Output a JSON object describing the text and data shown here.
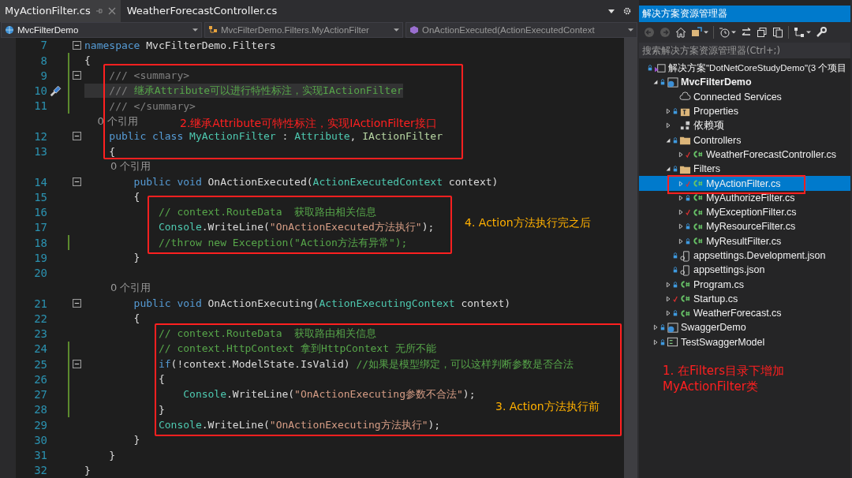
{
  "editor": {
    "tabs": [
      {
        "label": "MyActionFilter.cs",
        "selected": true
      },
      {
        "label": "WeatherForecastController.cs",
        "selected": false
      }
    ],
    "nav_bar": [
      {
        "kind": "project",
        "text": "MvcFilterDemo"
      },
      {
        "kind": "class",
        "text": "MvcFilterDemo.Filters.MyActionFilter"
      },
      {
        "kind": "method",
        "text": "OnActionExecuted(ActionExecutedContext"
      }
    ],
    "lines": [
      {
        "number": "7",
        "fold": true,
        "tokens": [
          {
            "kind": "kw",
            "text": "namespace"
          },
          {
            "kind": "plain",
            "text": " MvcFilterDemo.Filters"
          }
        ]
      },
      {
        "number": "8",
        "changed": true,
        "tokens": [
          {
            "kind": "plain",
            "text": "{"
          }
        ]
      },
      {
        "number": "9",
        "fold": true,
        "changed": true,
        "tokens": [
          {
            "kind": "doc",
            "text": "    /// <summary>"
          }
        ]
      },
      {
        "number": "10",
        "changed": true,
        "highlighted": true,
        "quick_action": true,
        "tokens": [
          {
            "kind": "doc",
            "text": "    /// "
          },
          {
            "kind": "comment",
            "text": "继承Attribute可以进行特性标注，实现IActionFilter"
          }
        ]
      },
      {
        "number": "11",
        "changed": true,
        "tokens": [
          {
            "kind": "doc",
            "text": "    /// </summary>"
          }
        ]
      },
      {
        "kind": "codelens",
        "text": "    0 个引用"
      },
      {
        "number": "12",
        "fold": true,
        "tokens": [
          {
            "kind": "kw",
            "text": "    public class"
          },
          {
            "kind": "type",
            "text": " MyActionFilter"
          },
          {
            "kind": "plain",
            "text": " : "
          },
          {
            "kind": "type",
            "text": "Attribute"
          },
          {
            "kind": "plain",
            "text": ", "
          },
          {
            "kind": "iface",
            "text": "IActionFilter"
          }
        ]
      },
      {
        "number": "13",
        "tokens": [
          {
            "kind": "plain",
            "text": "    {"
          }
        ]
      },
      {
        "kind": "codelens",
        "text": "        0 个引用"
      },
      {
        "number": "14",
        "fold": true,
        "tokens": [
          {
            "kind": "kw",
            "text": "        public void"
          },
          {
            "kind": "plain",
            "text": " OnActionExecuted("
          },
          {
            "kind": "type",
            "text": "ActionExecutedContext"
          },
          {
            "kind": "plain",
            "text": " context)"
          }
        ]
      },
      {
        "number": "15",
        "tokens": [
          {
            "kind": "plain",
            "text": "        {"
          }
        ]
      },
      {
        "number": "16",
        "tokens": [
          {
            "kind": "comment",
            "text": "            // context.RouteData  获取路由相关信息"
          }
        ]
      },
      {
        "number": "17",
        "tokens": [
          {
            "kind": "type",
            "text": "            Console"
          },
          {
            "kind": "plain",
            "text": ".WriteLine("
          },
          {
            "kind": "str",
            "text": "\"OnActionExecuted方法执行\""
          },
          {
            "kind": "plain",
            "text": ");"
          }
        ]
      },
      {
        "number": "18",
        "changed": true,
        "tokens": [
          {
            "kind": "comment",
            "text": "            //throw new Exception(\"Action方法有异常\");"
          }
        ]
      },
      {
        "number": "19",
        "tokens": [
          {
            "kind": "plain",
            "text": "        }"
          }
        ]
      },
      {
        "number": "20"
      },
      {
        "kind": "codelens",
        "text": "        0 个引用"
      },
      {
        "number": "21",
        "fold": true,
        "tokens": [
          {
            "kind": "kw",
            "text": "        public void"
          },
          {
            "kind": "plain",
            "text": " OnActionExecuting("
          },
          {
            "kind": "type",
            "text": "ActionExecutingContext"
          },
          {
            "kind": "plain",
            "text": " context)"
          }
        ]
      },
      {
        "number": "22",
        "tokens": [
          {
            "kind": "plain",
            "text": "        {"
          }
        ]
      },
      {
        "number": "23",
        "tokens": [
          {
            "kind": "comment",
            "text": "            // context.RouteData  获取路由相关信息"
          }
        ]
      },
      {
        "number": "24",
        "changed": true,
        "tokens": [
          {
            "kind": "comment",
            "text": "            // context.HttpContext 拿到HttpContext 无所不能"
          }
        ]
      },
      {
        "number": "25",
        "fold": true,
        "changed": true,
        "tokens": [
          {
            "kind": "kw",
            "text": "            if"
          },
          {
            "kind": "plain",
            "text": "(!context.ModelState.IsValid) "
          },
          {
            "kind": "comment",
            "text": "//如果是模型绑定，可以这样判断参数是否合法"
          }
        ]
      },
      {
        "number": "26",
        "changed": true,
        "tokens": [
          {
            "kind": "plain",
            "text": "            {"
          }
        ]
      },
      {
        "number": "27",
        "changed": true,
        "tokens": [
          {
            "kind": "type",
            "text": "                Console"
          },
          {
            "kind": "plain",
            "text": ".WriteLine("
          },
          {
            "kind": "str",
            "text": "\"OnActionExecuting参数不合法\""
          },
          {
            "kind": "plain",
            "text": ");"
          }
        ]
      },
      {
        "number": "28",
        "changed": true,
        "tokens": [
          {
            "kind": "plain",
            "text": "            }"
          }
        ]
      },
      {
        "number": "29",
        "tokens": [
          {
            "kind": "type",
            "text": "            Console"
          },
          {
            "kind": "plain",
            "text": ".WriteLine("
          },
          {
            "kind": "str",
            "text": "\"OnActionExecuting方法执行\""
          },
          {
            "kind": "plain",
            "text": ");"
          }
        ]
      },
      {
        "number": "30",
        "tokens": [
          {
            "kind": "plain",
            "text": "        }"
          }
        ]
      },
      {
        "number": "31",
        "tokens": [
          {
            "kind": "plain",
            "text": "    }"
          }
        ]
      },
      {
        "number": "32",
        "tokens": [
          {
            "kind": "plain",
            "text": "}"
          }
        ]
      }
    ],
    "annotations": [
      {
        "text": "2.继承Attribute可特性标注，实现IActionFilter接口",
        "color": "#ff2020"
      },
      {
        "text": "4. Action方法执行完之后",
        "color": "#ffb000"
      },
      {
        "text": "3. Action方法执行前",
        "color": "#ffb000"
      }
    ]
  },
  "explorer": {
    "title": "解决方案资源管理器",
    "search": {
      "placeholder": "搜索解决方案资源管理器(Ctrl+;)"
    },
    "tree": [
      {
        "kind": "solution",
        "locked": true,
        "label": "解决方案\"DotNetCoreStudyDemo\"(3 个项目",
        "selected": false,
        "children": [
          {
            "kind": "webproject",
            "locked": true,
            "label": "MvcFilterDemo",
            "bold": true,
            "expanded": true,
            "selected": false,
            "children": [
              {
                "kind": "connected",
                "label": "Connected Services",
                "selected": false
              },
              {
                "kind": "properties",
                "locked": true,
                "label": "Properties",
                "expanded": false,
                "selected": false
              },
              {
                "kind": "deps",
                "label": "依赖项",
                "expanded": false,
                "selected": false
              },
              {
                "kind": "folder",
                "locked": true,
                "label": "Controllers",
                "expanded": true,
                "selected": false,
                "children": [
                  {
                    "kind": "cs",
                    "edited": true,
                    "label": "WeatherForecastController.cs",
                    "expanded": false,
                    "selected": false
                  }
                ]
              },
              {
                "kind": "folder",
                "locked": true,
                "label": "Filters",
                "expanded": true,
                "selected": false,
                "children": [
                  {
                    "kind": "cs",
                    "edited": true,
                    "label": "MyActionFilter.cs",
                    "expanded": false,
                    "selected": true
                  },
                  {
                    "kind": "cs",
                    "locked": true,
                    "label": "MyAuthorizeFilter.cs",
                    "expanded": false,
                    "selected": false
                  },
                  {
                    "kind": "cs",
                    "edited": true,
                    "label": "MyExceptionFilter.cs",
                    "expanded": false,
                    "selected": false
                  },
                  {
                    "kind": "cs",
                    "locked": true,
                    "label": "MyResourceFilter.cs",
                    "expanded": false,
                    "selected": false
                  },
                  {
                    "kind": "cs",
                    "locked": true,
                    "label": "MyResultFilter.cs",
                    "expanded": false,
                    "selected": false
                  }
                ]
              },
              {
                "kind": "json",
                "locked": true,
                "label": "appsettings.Development.json",
                "selected": false
              },
              {
                "kind": "json",
                "locked": true,
                "label": "appsettings.json",
                "selected": false
              },
              {
                "kind": "cs",
                "locked": true,
                "label": "Program.cs",
                "expanded": false,
                "selected": false
              },
              {
                "kind": "cs",
                "edited": true,
                "label": "Startup.cs",
                "expanded": false,
                "selected": false
              },
              {
                "kind": "cs",
                "locked": true,
                "label": "WeatherForecast.cs",
                "expanded": false,
                "selected": false
              }
            ]
          },
          {
            "kind": "webproject",
            "locked": true,
            "label": "SwaggerDemo",
            "expanded": false,
            "selected": false
          },
          {
            "kind": "libproject",
            "locked": true,
            "label": "TestSwaggerModel",
            "expanded": false,
            "selected": false
          }
        ]
      }
    ],
    "annotation": {
      "text": "1. 在Filters目录下增加\nMyActionFilter类",
      "color": "#ff2020"
    }
  }
}
